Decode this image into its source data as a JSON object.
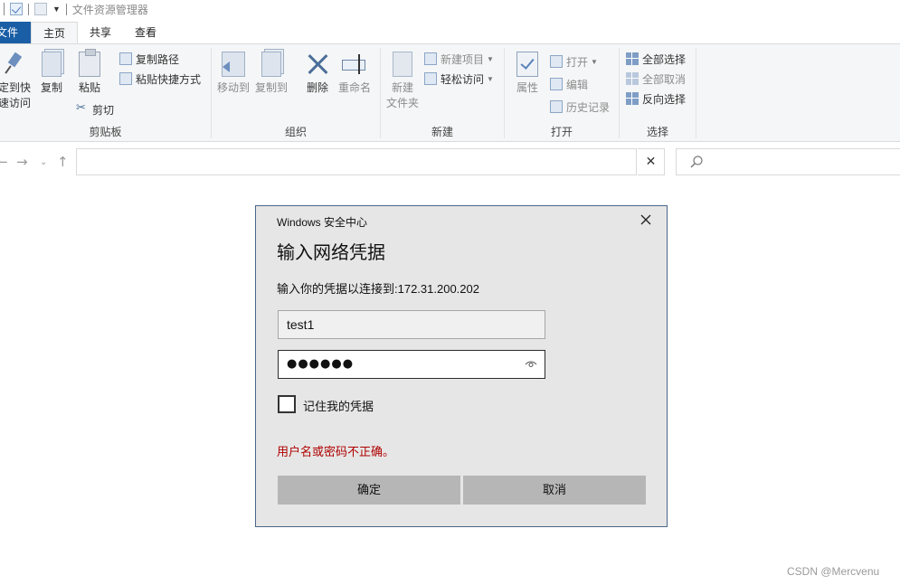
{
  "window": {
    "title": "文件资源管理器"
  },
  "ribbon": {
    "tabs": {
      "file": "文件",
      "home": "主页",
      "share": "共享",
      "view": "查看"
    },
    "clipboard": {
      "label": "剪贴板",
      "pin_line1": "定到快",
      "pin_line2": "速访问",
      "copy": "复制",
      "paste": "粘贴",
      "copy_path": "复制路径",
      "paste_shortcut": "粘贴快捷方式",
      "cut": "剪切"
    },
    "organize": {
      "label": "组织",
      "move_to": "移动到",
      "copy_to": "复制到",
      "delete": "删除",
      "rename": "重命名"
    },
    "new": {
      "label": "新建",
      "new_folder_line1": "新建",
      "new_folder_line2": "文件夹",
      "new_item": "新建项目",
      "easy_access": "轻松访问"
    },
    "open": {
      "label": "打开",
      "properties": "属性",
      "open": "打开",
      "edit": "编辑",
      "history": "历史记录"
    },
    "select": {
      "label": "选择",
      "select_all": "全部选择",
      "select_none": "全部取消",
      "invert": "反向选择"
    }
  },
  "dialog": {
    "caption": "Windows 安全中心",
    "heading": "输入网络凭据",
    "message": "输入你的凭据以连接到:172.31.200.202",
    "username_value": "test1",
    "password_mask": "●●●●●●",
    "remember_label": "记住我的凭据",
    "remember_checked": false,
    "error": "用户名或密码不正确。",
    "ok_label": "确定",
    "cancel_label": "取消"
  },
  "watermark": "CSDN @Mercvenu",
  "colors": {
    "file_tab": "#1a5fa6",
    "error": "#b00000",
    "dialog_border": "#49678a"
  }
}
